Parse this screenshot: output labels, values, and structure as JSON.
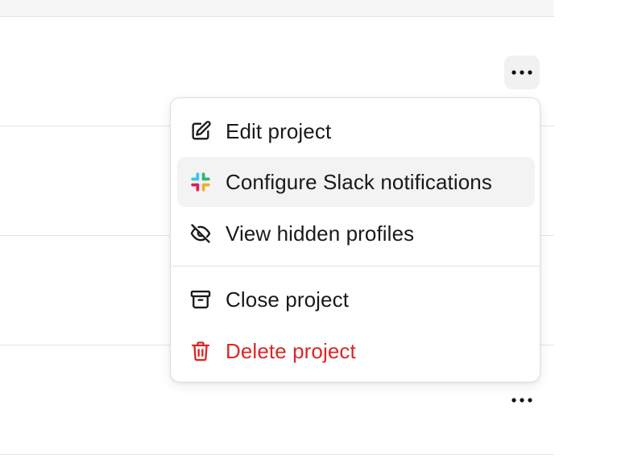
{
  "menu": {
    "items": [
      {
        "label": "Edit project",
        "icon": "pencil-square-icon"
      },
      {
        "label": "Configure Slack notifications",
        "icon": "slack-icon"
      },
      {
        "label": "View hidden profiles",
        "icon": "eye-off-icon"
      },
      {
        "label": "Close project",
        "icon": "archive-icon"
      },
      {
        "label": "Delete project",
        "icon": "trash-icon"
      }
    ]
  },
  "colors": {
    "danger": "#dc2626",
    "text": "#1a1a1a",
    "highlight": "#f3f3f3"
  }
}
